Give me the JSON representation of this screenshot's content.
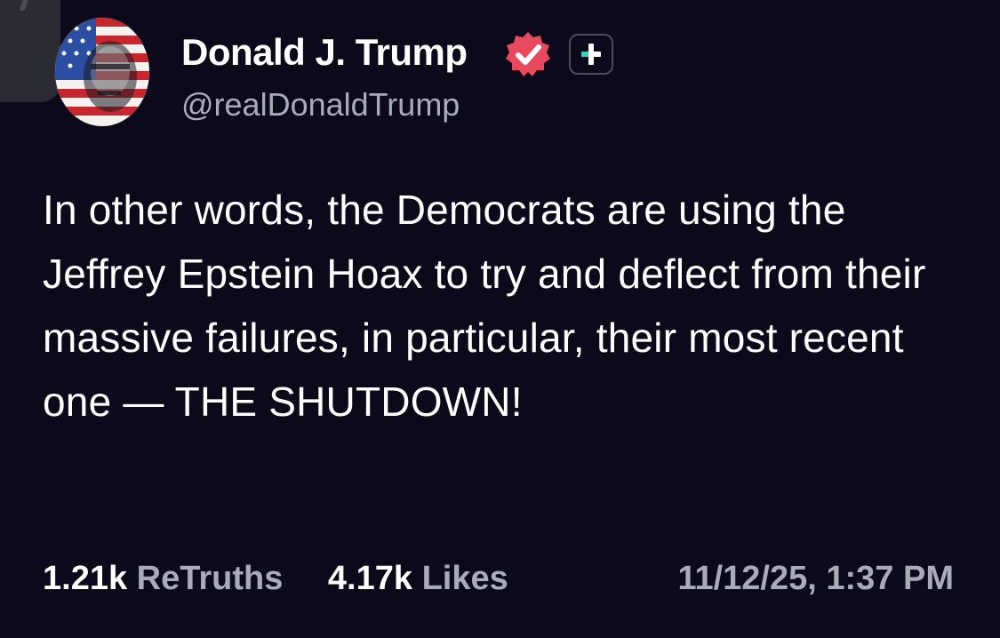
{
  "author": {
    "display_name": "Donald J. Trump",
    "handle": "@realDonaldTrump",
    "verified_badge_icon": "verified-check-icon",
    "plus_badge_icon": "plus-icon",
    "accent_colors": {
      "verified": "#e8495f",
      "plus": "#3ad0bf"
    }
  },
  "post": {
    "text": "In other words, the Democrats are using the Jeffrey Epstein Hoax to try and deflect from their massive failures, in particular, their most recent one — THE SHUTDOWN!"
  },
  "stats": {
    "retruths_count": "1.21k",
    "retruths_label": "ReTruths",
    "likes_count": "4.17k",
    "likes_label": "Likes",
    "timestamp": "11/12/25, 1:37 PM"
  },
  "colors": {
    "background": "#0c0a1a",
    "text_primary": "#ffffff",
    "text_secondary": "#a9abb8"
  }
}
